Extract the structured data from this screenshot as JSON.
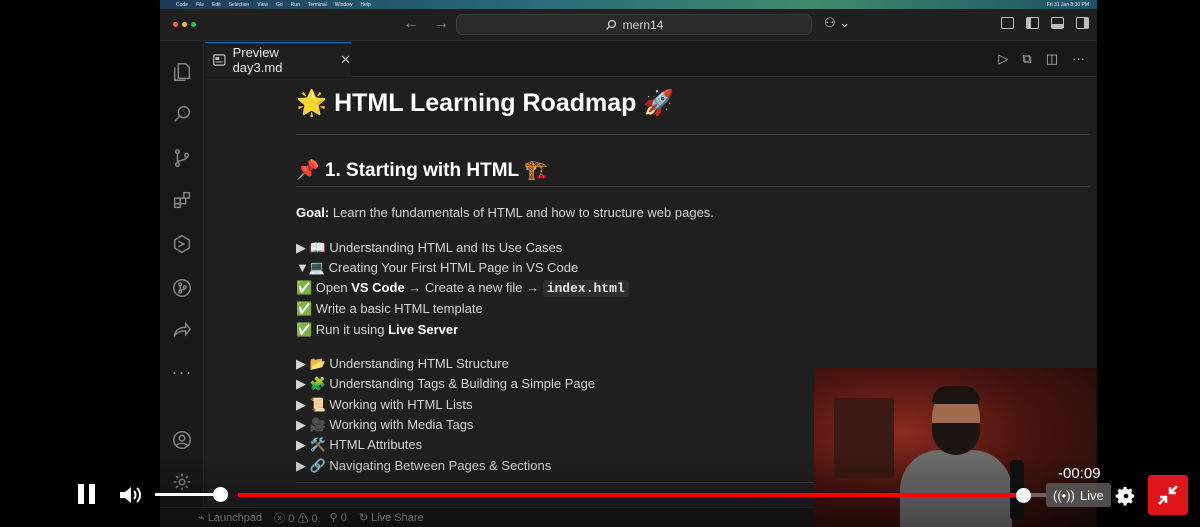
{
  "menubar": {
    "items": [
      "Code",
      "File",
      "Edit",
      "Selection",
      "View",
      "Go",
      "Run",
      "Terminal",
      "Window",
      "Help"
    ],
    "clock": "Fri 31 Jan 8:30 PM"
  },
  "titlebar": {
    "search_text": "mern14"
  },
  "tab": {
    "label": "Preview day3.md",
    "close_glyph": "✕"
  },
  "content": {
    "h1": "🌟 HTML Learning Roadmap 🚀",
    "h2": "📌 1. Starting with HTML 🏗️",
    "goal_label": "Goal:",
    "goal_text": " Learn the fundamentals of HTML and how to structure web pages.",
    "sections": [
      "▶ 📖 Understanding HTML and Its Use Cases",
      "▼💻 Creating Your First HTML Page in VS Code"
    ],
    "steps": {
      "step1_prefix": "✅ Open ",
      "step1_bold": "VS Code",
      "step1_mid": " → Create a new file → ",
      "step1_code": "index.html",
      "step2": "✅ Write a basic HTML template",
      "step3_prefix": "✅ Run it using ",
      "step3_bold": "Live Server"
    },
    "more_sections": [
      "▶ 📂 Understanding HTML Structure",
      "▶ 🧩 Understanding Tags & Building a Simple Page",
      "▶ 📜 Working with HTML Lists",
      "▶ 🎥 Working with Media Tags",
      "▶ 🛠️ HTML Attributes",
      "▶ 🔗 Navigating Between Pages & Sections"
    ]
  },
  "statusbar": {
    "launchpad": "Launchpad",
    "errors": "0",
    "warnings": "0",
    "ports": "0",
    "liveshare": "Live Share"
  },
  "player": {
    "time": "-00:09",
    "live_label": "Live",
    "volume": 0.9,
    "progress": 0.972,
    "accent_color": "#ff0000"
  }
}
